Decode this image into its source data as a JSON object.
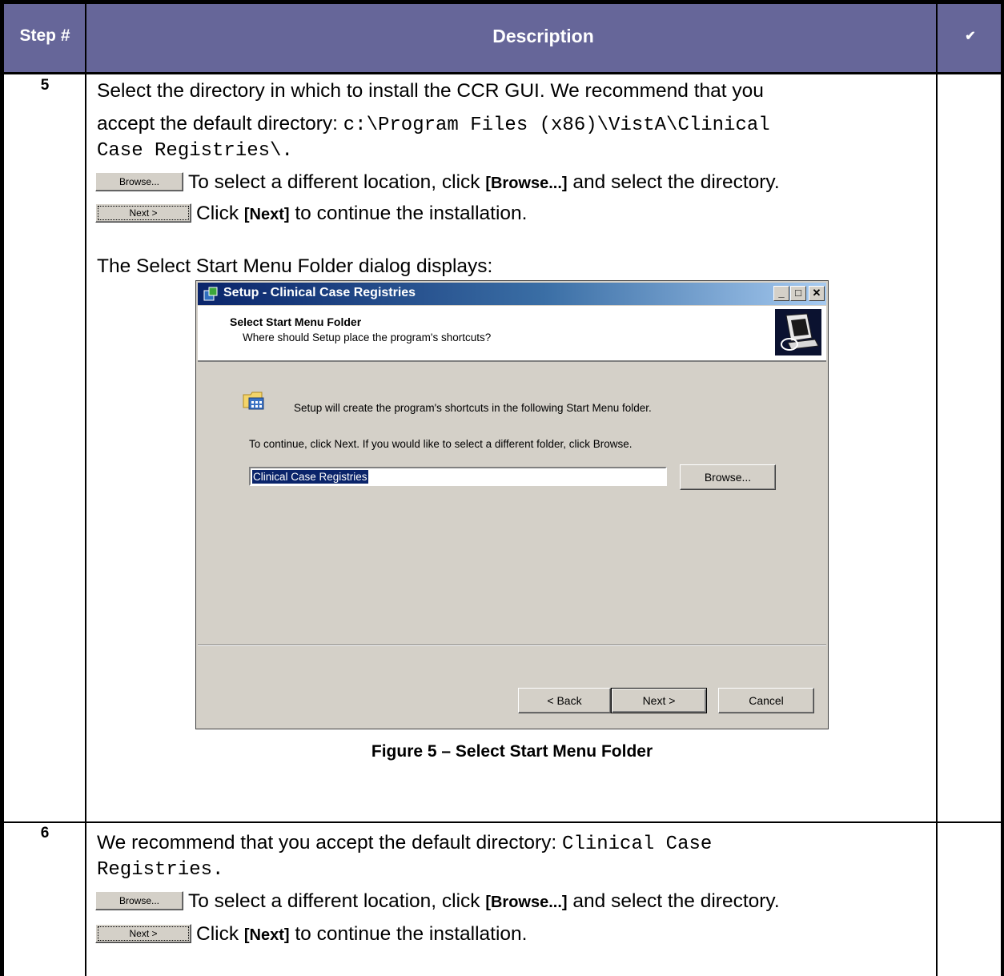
{
  "header": {
    "step_label": "Step #",
    "description_label": "Description",
    "check_label": "✔"
  },
  "step5": {
    "number": "5",
    "line1": "Select the directory in which to install the CCR GUI. We recommend that you",
    "line2_prefix": "accept the default directory: ",
    "line2_path": "c:\\Program Files (x86)\\VistA\\Clinical",
    "line3_path": "Case Registries\\.",
    "browse_icon_label": "Browse...",
    "browse_text_a": "To select a different location, click ",
    "browse_text_bold": "[Browse...]",
    "browse_text_b": " and select the directory.",
    "next_icon_label": "Next >",
    "next_text_a": "Click ",
    "next_text_bold": "[Next]",
    "next_text_b": " to continue the installation.",
    "dialog_intro": "The Select Start Menu Folder dialog displays:",
    "caption": "Figure 5 – Select Start Menu Folder"
  },
  "dialog": {
    "title": "Setup - Clinical Case Registries",
    "banner_title": "Select Start Menu Folder",
    "banner_subtitle": "Where should Setup place the program's shortcuts?",
    "body_line1": "Setup will create the program's shortcuts in the following Start Menu folder.",
    "body_line2": "To continue, click Next. If you would like to select a different folder, click Browse.",
    "folder_value": "Clinical Case Registries",
    "browse_label": "Browse...",
    "back_label": "< Back",
    "next_label": "Next >",
    "cancel_label": "Cancel",
    "min_glyph": "_",
    "max_glyph": "□",
    "close_glyph": "✕"
  },
  "step6": {
    "number": "6",
    "line1_prefix": "We recommend that you accept the default directory: ",
    "line1_path": "Clinical Case",
    "line2_path": "Registries.",
    "browse_icon_label": "Browse...",
    "browse_text_a": "To select a different location, click ",
    "browse_text_bold": "[Browse...]",
    "browse_text_b": " and select the directory.",
    "next_icon_label": "Next >",
    "next_text_a": "Click ",
    "next_text_bold": "[Next]",
    "next_text_b": " to continue the installation."
  },
  "colors": {
    "header_bg": "#666699",
    "titlebar_start": "#0a246a",
    "dialog_face": "#d4d0c8"
  }
}
